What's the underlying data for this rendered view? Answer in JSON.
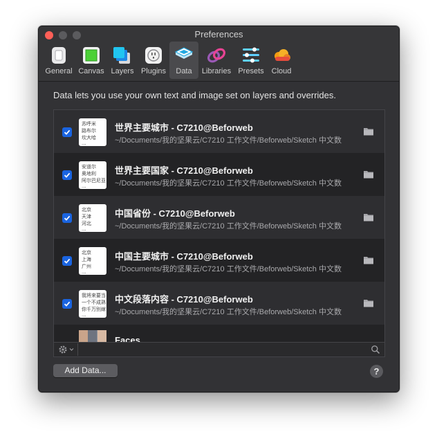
{
  "window": {
    "title": "Preferences"
  },
  "toolbar": [
    {
      "label": "General",
      "icon": "general-icon"
    },
    {
      "label": "Canvas",
      "icon": "canvas-icon"
    },
    {
      "label": "Layers",
      "icon": "layers-icon"
    },
    {
      "label": "Plugins",
      "icon": "plugins-icon"
    },
    {
      "label": "Data",
      "icon": "data-icon",
      "selected": true
    },
    {
      "label": "Libraries",
      "icon": "libraries-icon"
    },
    {
      "label": "Presets",
      "icon": "presets-icon"
    },
    {
      "label": "Cloud",
      "icon": "cloud-icon"
    }
  ],
  "description": "Data lets you use your own text and image set on layers and overrides.",
  "data_sets": [
    {
      "title": "世界主要城市 - C7210@Beforweb",
      "path": "~/Documents/我的坚果云/C7210 工作文件/Beforweb/Sketch 中文数",
      "checked": true,
      "thumb": [
        "苏呼米",
        "路布尔",
        "坎大哈",
        "···"
      ]
    },
    {
      "title": "世界主要国家 - C7210@Beforweb",
      "path": "~/Documents/我的坚果云/C7210 工作文件/Beforweb/Sketch 中文数",
      "checked": true,
      "thumb": [
        "安道尔",
        "奥地利",
        "阿尔巴尼亚",
        "···"
      ]
    },
    {
      "title": "中国省份 - C7210@Beforweb",
      "path": "~/Documents/我的坚果云/C7210 工作文件/Beforweb/Sketch 中文数",
      "checked": true,
      "thumb": [
        "北京",
        "天津",
        "河北",
        "···"
      ]
    },
    {
      "title": "中国主要城市 - C7210@Beforweb",
      "path": "~/Documents/我的坚果云/C7210 工作文件/Beforweb/Sketch 中文数",
      "checked": true,
      "thumb": [
        "北京",
        "上海",
        "广州",
        "···"
      ]
    },
    {
      "title": "中文段落内容 - C7210@Beforweb",
      "path": "~/Documents/我的坚果云/C7210 工作文件/Beforweb/Sketch 中文数",
      "checked": true,
      "thumb": [
        "我将来要当",
        "一个不成熟",
        "你千万别嫁",
        "···"
      ]
    },
    {
      "title": "Faces",
      "path": "",
      "checked": true,
      "thumb": []
    }
  ],
  "buttons": {
    "add_data": "Add Data...",
    "help": "?"
  },
  "colors": {
    "accent": "#1a64e0",
    "close": "#fe5f57"
  }
}
